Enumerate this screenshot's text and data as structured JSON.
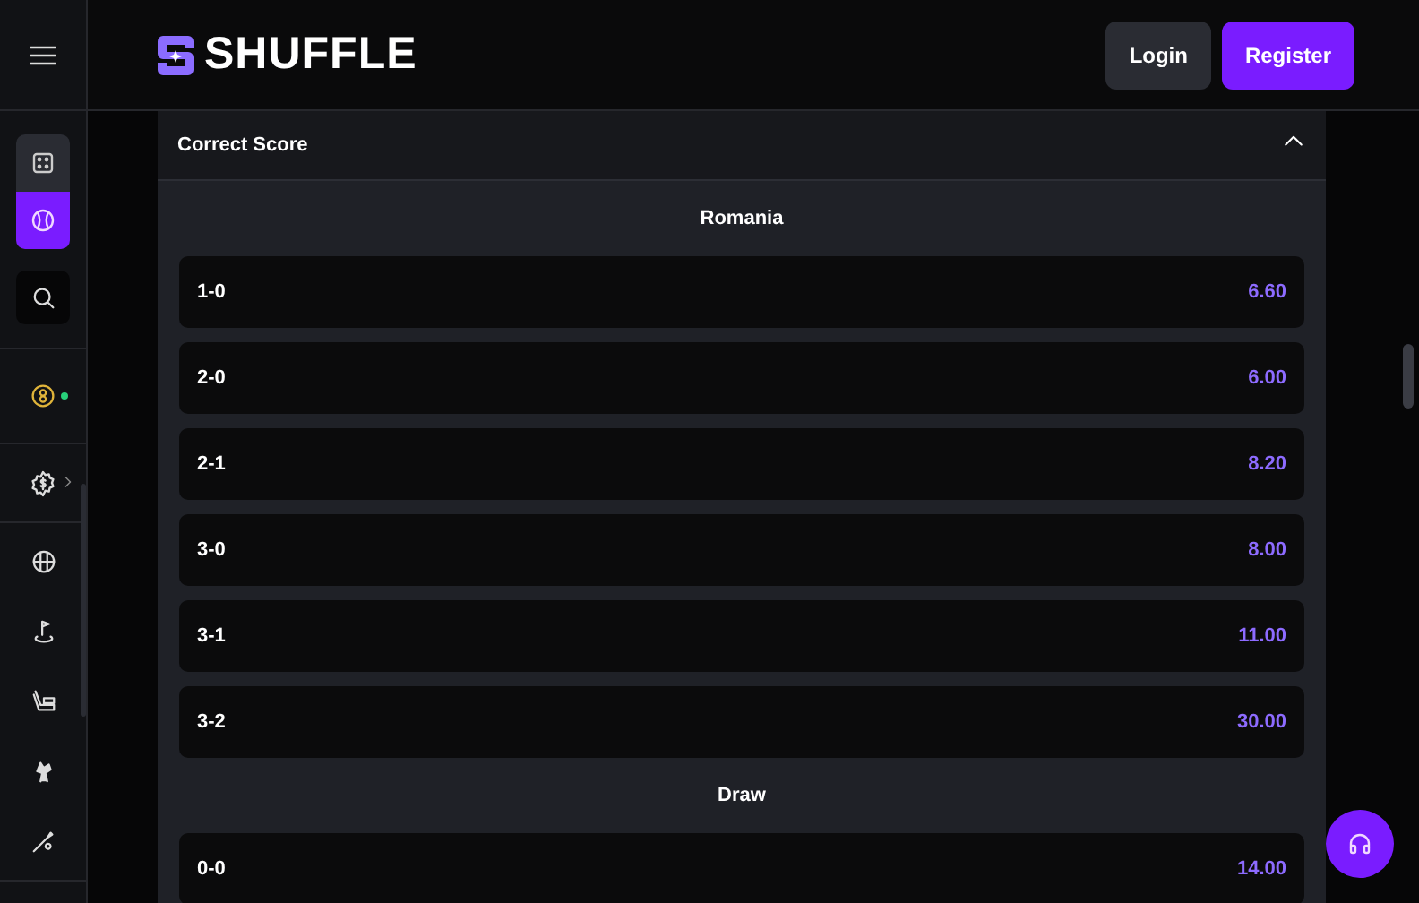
{
  "header": {
    "brand": "SHUFFLE",
    "buttons": [
      {
        "label": "Login",
        "kind": "secondary"
      },
      {
        "label": "Register",
        "kind": "primary"
      }
    ]
  },
  "sidebar": {
    "modes": [
      {
        "kind": "dice",
        "selected": false
      },
      {
        "kind": "ball",
        "selected": true
      }
    ]
  },
  "market": {
    "title": "Correct Score",
    "expanded": true,
    "groups": [
      {
        "name": "Romania",
        "outcomes": [
          {
            "score": "1-0",
            "odds": "6.60"
          },
          {
            "score": "2-0",
            "odds": "6.00"
          },
          {
            "score": "2-1",
            "odds": "8.20"
          },
          {
            "score": "3-0",
            "odds": "8.00"
          },
          {
            "score": "3-1",
            "odds": "11.00"
          },
          {
            "score": "3-2",
            "odds": "30.00"
          }
        ]
      },
      {
        "name": "Draw",
        "outcomes": [
          {
            "score": "0-0",
            "odds": "14.00"
          }
        ]
      }
    ]
  }
}
